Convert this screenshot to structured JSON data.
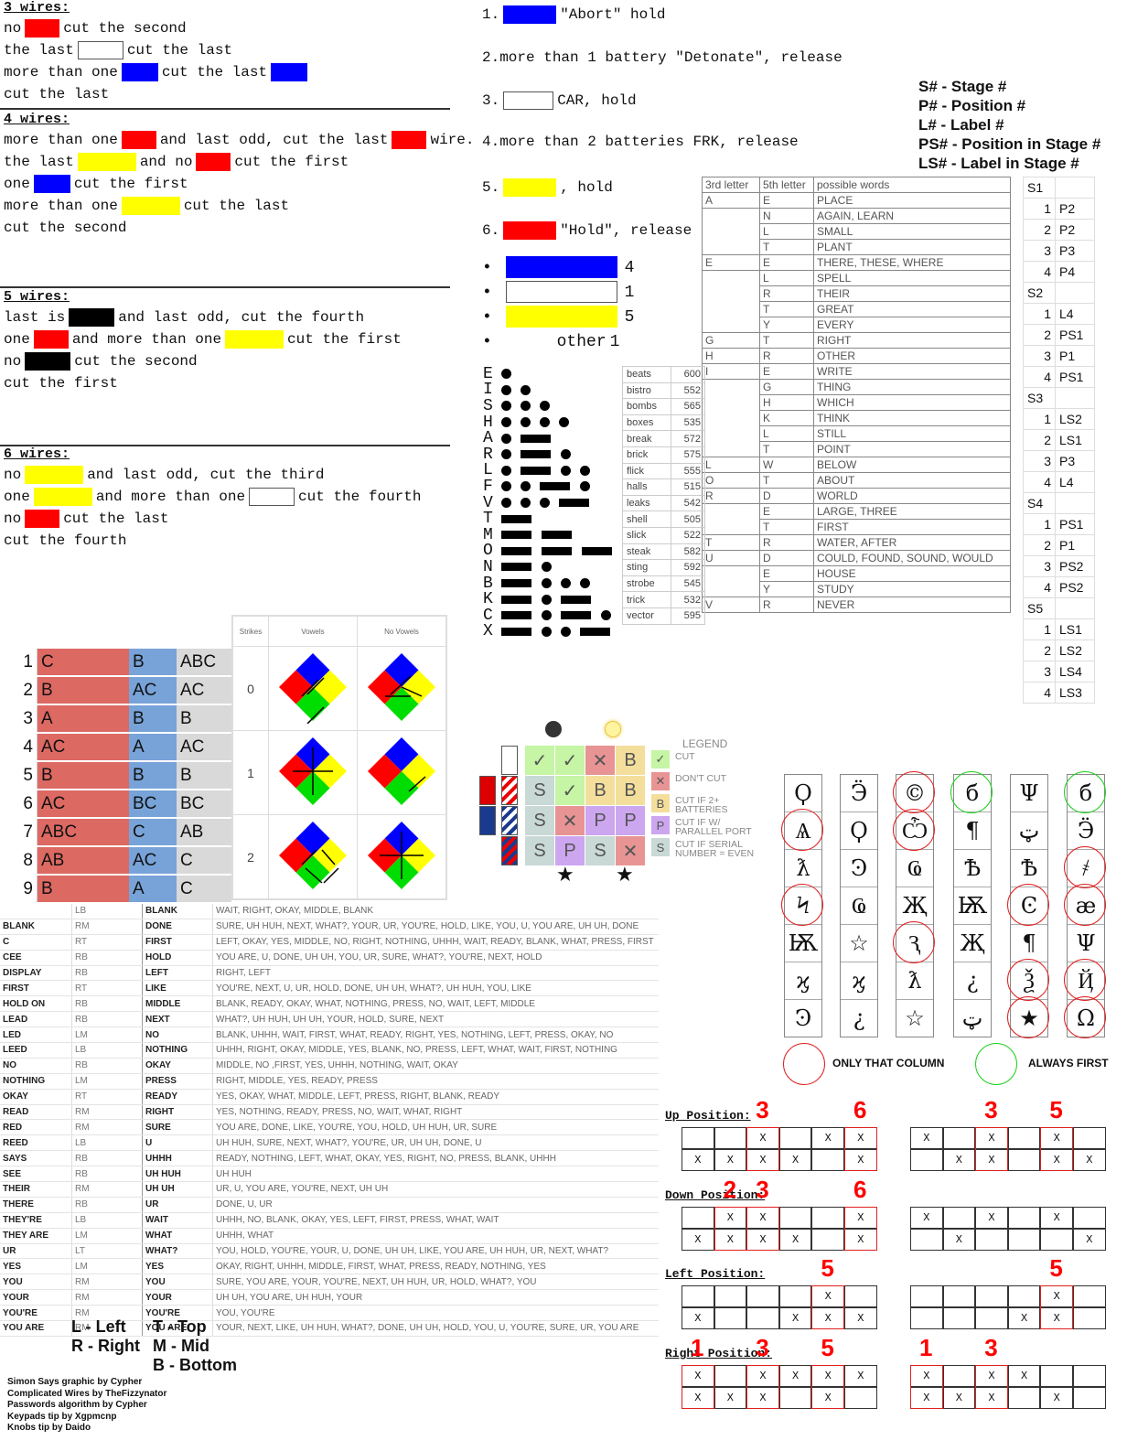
{
  "wires": {
    "s3": {
      "title": "3 wires:",
      "lines": [
        {
          "pre": "no",
          "sw": "red",
          "post": "cut the second"
        },
        {
          "pre": "the last",
          "sw": "white",
          "post": "cut the last"
        },
        {
          "pre": "more than one",
          "sw": "blue",
          "post": "cut the last",
          "sw2": "blue"
        },
        {
          "pre": "cut the last"
        }
      ]
    },
    "s4": {
      "title": "4 wires:",
      "lines": [
        {
          "pre": "more than one",
          "sw": "red",
          "post": "and  last  odd, cut the last",
          "sw2": "red",
          "post2": "wire."
        },
        {
          "pre": "the last",
          "sw": "yellow",
          "post": "and no",
          "sw2": "red",
          "post2": "cut the first"
        },
        {
          "pre": "one",
          "sw": "blue",
          "post": "cut the first"
        },
        {
          "pre": "more than one",
          "sw": "yellow",
          "post": "cut the last"
        },
        {
          "pre": "cut the second"
        }
      ]
    },
    "s5": {
      "title": "5 wires:",
      "lines": [
        {
          "pre": "last is",
          "sw": "black",
          "post": "and  last  odd, cut the fourth"
        },
        {
          "pre": "one",
          "sw": "red",
          "post": "and  more than one",
          "sw2": "yellow",
          "post2": "cut the first"
        },
        {
          "pre": "no",
          "sw": "black",
          "post": "cut the second"
        },
        {
          "pre": "cut the first"
        }
      ]
    },
    "s6": {
      "title": "6 wires:",
      "lines": [
        {
          "pre": "no",
          "sw": "yellow",
          "post": "and  last  odd, cut  the third"
        },
        {
          "pre": "one",
          "sw": "yellow",
          "post": "and  more than one",
          "sw2": "white",
          "post2": "cut the fourth"
        },
        {
          "pre": "no",
          "sw": "red",
          "post": "cut the last"
        },
        {
          "pre": "cut the fourth"
        }
      ]
    }
  },
  "button": {
    "rules": [
      {
        "num": "1.",
        "sw": "blue",
        "text": "\"Abort\" hold"
      },
      {
        "num": "2.",
        "text": "more than 1 battery \"Detonate\", release"
      },
      {
        "num": "3.",
        "sw": "white",
        "text": "CAR,  hold"
      },
      {
        "num": "4.",
        "text": "more than 2 batteries FRK, release"
      },
      {
        "num": "5.",
        "sw": "yellow",
        "text": ", hold"
      },
      {
        "num": "6.",
        "sw": "red",
        "text": "\"Hold\", release"
      }
    ],
    "strips": [
      {
        "color": "blue",
        "value": "4"
      },
      {
        "color": "white",
        "value": "1"
      },
      {
        "color": "yellow",
        "value": "5"
      },
      {
        "label": "other",
        "value": "1"
      }
    ]
  },
  "passwords": {
    "headers": [
      "3rd letter",
      "5th letter",
      "possible words"
    ],
    "rows": [
      [
        "A",
        "E",
        "PLACE"
      ],
      [
        "",
        "N",
        "AGAIN, LEARN"
      ],
      [
        "",
        "L",
        "SMALL"
      ],
      [
        "",
        "T",
        "PLANT"
      ],
      [
        "E",
        "E",
        "THERE, THESE, WHERE"
      ],
      [
        "",
        "L",
        "SPELL"
      ],
      [
        "",
        "R",
        "THEIR"
      ],
      [
        "",
        "T",
        "GREAT"
      ],
      [
        "",
        "Y",
        "EVERY"
      ],
      [
        "G",
        "T",
        "RIGHT"
      ],
      [
        "H",
        "R",
        "OTHER"
      ],
      [
        "I",
        "E",
        "WRITE"
      ],
      [
        "",
        "G",
        "THING"
      ],
      [
        "",
        "H",
        "WHICH"
      ],
      [
        "",
        "K",
        "THINK"
      ],
      [
        "",
        "L",
        "STILL"
      ],
      [
        "",
        "T",
        "POINT"
      ],
      [
        "L",
        "W",
        "BELOW"
      ],
      [
        "O",
        "T",
        "ABOUT"
      ],
      [
        "R",
        "D",
        "WORLD"
      ],
      [
        "",
        "E",
        "LARGE, THREE"
      ],
      [
        "",
        "T",
        "FIRST"
      ],
      [
        "T",
        "R",
        "WATER, AFTER"
      ],
      [
        "U",
        "D",
        "COULD, FOUND, SOUND, WOULD"
      ],
      [
        "",
        "E",
        "HOUSE"
      ],
      [
        "",
        "Y",
        "STUDY"
      ],
      [
        "V",
        "R",
        "NEVER"
      ]
    ]
  },
  "frequencies": [
    [
      "beats",
      "600"
    ],
    [
      "bistro",
      "552"
    ],
    [
      "bombs",
      "565"
    ],
    [
      "boxes",
      "535"
    ],
    [
      "break",
      "572"
    ],
    [
      "brick",
      "575"
    ],
    [
      "flick",
      "555"
    ],
    [
      "halls",
      "515"
    ],
    [
      "leaks",
      "542"
    ],
    [
      "shell",
      "505"
    ],
    [
      "slick",
      "522"
    ],
    [
      "steak",
      "582"
    ],
    [
      "sting",
      "592"
    ],
    [
      "strobe",
      "545"
    ],
    [
      "trick",
      "532"
    ],
    [
      "vector",
      "595"
    ]
  ],
  "memory": {
    "codes": [
      "S# - Stage #",
      "P# - Position #",
      "L# - Label #",
      "PS# - Position in Stage #",
      "LS# - Label in Stage #"
    ],
    "stages": [
      {
        "label": "S1",
        "steps": [
          "P2",
          "P2",
          "P3",
          "P4"
        ]
      },
      {
        "label": "S2",
        "steps": [
          "L4",
          "PS1",
          "P1",
          "PS1"
        ]
      },
      {
        "label": "S3",
        "steps": [
          "LS2",
          "LS1",
          "P3",
          "L4"
        ]
      },
      {
        "label": "S4",
        "steps": [
          "PS1",
          "P1",
          "PS2",
          "PS2"
        ]
      },
      {
        "label": "S5",
        "steps": [
          "LS1",
          "LS2",
          "LS4",
          "LS3"
        ]
      }
    ]
  },
  "morse": [
    {
      "l": "E",
      "c": "."
    },
    {
      "l": "I",
      "c": ".."
    },
    {
      "l": "S",
      "c": "..."
    },
    {
      "l": "H",
      "c": "...."
    },
    {
      "l": "A",
      "c": ".-"
    },
    {
      "l": "R",
      "c": ".-."
    },
    {
      "l": "L",
      "c": ".-.."
    },
    {
      "l": "F",
      "c": "..-."
    },
    {
      "l": "V",
      "c": "...-"
    },
    {
      "l": "T",
      "c": "-"
    },
    {
      "l": "M",
      "c": "--"
    },
    {
      "l": "O",
      "c": "---"
    },
    {
      "l": "N",
      "c": "-."
    },
    {
      "l": "B",
      "c": "-..."
    },
    {
      "l": "K",
      "c": "-.-"
    },
    {
      "l": "C",
      "c": "-.-."
    },
    {
      "l": "X",
      "c": "-..-"
    }
  ],
  "wof_steps": [
    [
      "1",
      "C",
      "B",
      "ABC"
    ],
    [
      "2",
      "B",
      "AC",
      "AC"
    ],
    [
      "3",
      "A",
      "B",
      "B"
    ],
    [
      "4",
      "AC",
      "A",
      "AC"
    ],
    [
      "5",
      "B",
      "B",
      "B"
    ],
    [
      "6",
      "AC",
      "BC",
      "BC"
    ],
    [
      "7",
      "ABC",
      "C",
      "AB"
    ],
    [
      "8",
      "AB",
      "AC",
      "C"
    ],
    [
      "9",
      "B",
      "A",
      "C"
    ]
  ],
  "simon": {
    "headers": [
      "Strikes",
      "Vowels",
      "No Vowels"
    ],
    "rows": [
      "0",
      "1",
      "2"
    ]
  },
  "complicated": {
    "legend_title": "LEGEND",
    "grid": [
      [
        "C",
        "C",
        "X",
        "B"
      ],
      [
        "S",
        "C",
        "B",
        "B"
      ],
      [
        "S",
        "X",
        "P",
        "P"
      ],
      [
        "S",
        "P",
        "S",
        "X"
      ]
    ],
    "legend": [
      {
        "code": "C",
        "label": "CUT"
      },
      {
        "code": "X",
        "label": "DON'T CUT"
      },
      {
        "code": "B",
        "label": "CUT IF 2+ BATTERIES"
      },
      {
        "code": "P",
        "label": "CUT IF W/ PARALLEL PORT"
      },
      {
        "code": "S",
        "label": "CUT IF SERIAL NUMBER = EVEN"
      }
    ]
  },
  "keypad": {
    "columns": [
      [
        {
          "g": "Ϙ"
        },
        {
          "g": "Ѧ",
          "r": "red"
        },
        {
          "g": "ƛ"
        },
        {
          "g": "Ϟ",
          "r": "red"
        },
        {
          "g": "Ѭ"
        },
        {
          "g": "ϗ"
        },
        {
          "g": "Ͽ"
        }
      ],
      [
        {
          "g": "Ӭ"
        },
        {
          "g": "Ϙ"
        },
        {
          "g": "Ͽ"
        },
        {
          "g": "Ҩ"
        },
        {
          "g": "☆"
        },
        {
          "g": "ϗ"
        },
        {
          "g": "¿"
        }
      ],
      [
        {
          "g": "©",
          "r": "red"
        },
        {
          "g": "Ѽ",
          "r": "red"
        },
        {
          "g": "Ҩ"
        },
        {
          "g": "Җ"
        },
        {
          "g": "Ԇ",
          "r": "red"
        },
        {
          "g": "ƛ"
        },
        {
          "g": "☆"
        }
      ],
      [
        {
          "g": "б",
          "r": "green"
        },
        {
          "g": "¶"
        },
        {
          "g": "Ѣ"
        },
        {
          "g": "Ѭ"
        },
        {
          "g": "Җ"
        },
        {
          "g": "¿"
        },
        {
          "g": "ټ"
        }
      ],
      [
        {
          "g": "Ψ"
        },
        {
          "g": "ټ"
        },
        {
          "g": "Ѣ"
        },
        {
          "g": "Ͼ",
          "r": "red"
        },
        {
          "g": "¶"
        },
        {
          "g": "Ѯ",
          "r": "red"
        },
        {
          "g": "★",
          "r": "red"
        }
      ],
      [
        {
          "g": "б",
          "r": "green"
        },
        {
          "g": "Ӭ"
        },
        {
          "g": "҂",
          "r": "red"
        },
        {
          "g": "æ",
          "r": "red"
        },
        {
          "g": "Ψ"
        },
        {
          "g": "Ҋ",
          "r": "red"
        },
        {
          "g": "Ω",
          "r": "red"
        }
      ]
    ],
    "legend_red": "ONLY THAT COLUMN",
    "legend_green": "ALWAYS FIRST"
  },
  "whos_on_first": {
    "display_rows": [
      [
        "",
        "LB"
      ],
      [
        "BLANK",
        "RM"
      ],
      [
        "C",
        "RT"
      ],
      [
        "CEE",
        "RB"
      ],
      [
        "DISPLAY",
        "RB"
      ],
      [
        "FIRST",
        "RT"
      ],
      [
        "HOLD ON",
        "RB"
      ],
      [
        "LEAD",
        "RB"
      ],
      [
        "LED",
        "LM"
      ],
      [
        "LEED",
        "LB"
      ],
      [
        "NO",
        "RB"
      ],
      [
        "NOTHING",
        "LM"
      ],
      [
        "OKAY",
        "RT"
      ],
      [
        "READ",
        "RM"
      ],
      [
        "RED",
        "RM"
      ],
      [
        "REED",
        "LB"
      ],
      [
        "SAYS",
        "RB"
      ],
      [
        "SEE",
        "RB"
      ],
      [
        "THEIR",
        "RM"
      ],
      [
        "THERE",
        "RB"
      ],
      [
        "THEY'RE",
        "LB"
      ],
      [
        "THEY ARE",
        "LM"
      ],
      [
        "UR",
        "LT"
      ],
      [
        "YES",
        "LM"
      ],
      [
        "YOU",
        "RM"
      ],
      [
        "YOUR",
        "RM"
      ],
      [
        "YOU'RE",
        "RM"
      ],
      [
        "YOU ARE",
        "RM"
      ]
    ],
    "word_rows": [
      [
        "BLANK",
        "WAIT, RIGHT, OKAY, MIDDLE, BLANK"
      ],
      [
        "DONE",
        "SURE, UH HUH, NEXT, WHAT?, YOUR, UR, YOU'RE, HOLD, LIKE, YOU, U, YOU ARE, UH UH, DONE"
      ],
      [
        "FIRST",
        "LEFT, OKAY, YES, MIDDLE, NO, RIGHT, NOTHING, UHHH, WAIT, READY, BLANK, WHAT, PRESS, FIRST"
      ],
      [
        "HOLD",
        "YOU ARE, U, DONE, UH UH, YOU, UR, SURE, WHAT?, YOU'RE, NEXT, HOLD"
      ],
      [
        "LEFT",
        "RIGHT, LEFT"
      ],
      [
        "LIKE",
        "YOU'RE, NEXT, U, UR, HOLD, DONE, UH UH, WHAT?, UH HUH, YOU, LIKE"
      ],
      [
        "MIDDLE",
        "BLANK, READY, OKAY, WHAT, NOTHING, PRESS, NO, WAIT, LEFT, MIDDLE"
      ],
      [
        "NEXT",
        "WHAT?, UH HUH, UH UH, YOUR, HOLD, SURE, NEXT"
      ],
      [
        "NO",
        "BLANK, UHHH, WAIT, FIRST, WHAT, READY, RIGHT, YES, NOTHING, LEFT, PRESS, OKAY, NO"
      ],
      [
        "NOTHING",
        "UHHH, RIGHT, OKAY, MIDDLE, YES, BLANK, NO, PRESS, LEFT, WHAT, WAIT, FIRST, NOTHING"
      ],
      [
        "OKAY",
        "MIDDLE, NO ,FIRST, YES, UHHH, NOTHING, WAIT, OKAY"
      ],
      [
        "PRESS",
        "RIGHT, MIDDLE, YES, READY, PRESS"
      ],
      [
        "READY",
        "YES, OKAY, WHAT, MIDDLE, LEFT, PRESS, RIGHT, BLANK, READY"
      ],
      [
        "RIGHT",
        "YES, NOTHING, READY, PRESS, NO, WAIT, WHAT, RIGHT"
      ],
      [
        "SURE",
        "YOU ARE, DONE, LIKE, YOU'RE, YOU, HOLD, UH HUH, UR, SURE"
      ],
      [
        "U",
        "UH HUH, SURE, NEXT, WHAT?, YOU'RE, UR, UH UH, DONE, U"
      ],
      [
        "UHHH",
        "READY, NOTHING, LEFT, WHAT, OKAY, YES, RIGHT, NO, PRESS, BLANK, UHHH"
      ],
      [
        "UH HUH",
        "UH HUH"
      ],
      [
        "UH UH",
        "UR, U, YOU ARE, YOU'RE, NEXT, UH UH"
      ],
      [
        "UR",
        "DONE, U, UR"
      ],
      [
        "WAIT",
        "UHHH, NO, BLANK, OKAY, YES, LEFT, FIRST, PRESS, WHAT, WAIT"
      ],
      [
        "WHAT",
        "UHHH, WHAT"
      ],
      [
        "WHAT?",
        "YOU, HOLD, YOU'RE, YOUR, U, DONE, UH UH, LIKE, YOU ARE, UH HUH, UR, NEXT, WHAT?"
      ],
      [
        "YES",
        "OKAY, RIGHT, UHHH, MIDDLE, FIRST, WHAT, PRESS, READY, NOTHING, YES"
      ],
      [
        "YOU",
        "SURE, YOU ARE, YOUR, YOU'RE, NEXT, UH HUH, UR, HOLD, WHAT?, YOU"
      ],
      [
        "YOUR",
        "UH UH, YOU ARE, UH HUH, YOUR"
      ],
      [
        "YOU'RE",
        "YOU, YOU'RE"
      ],
      [
        "YOU ARE",
        "YOUR, NEXT, LIKE, UH HUH, WHAT?, DONE, UH UH, HOLD, YOU, U, YOU'RE, SURE, UR, YOU ARE"
      ]
    ],
    "position_key_left": [
      "L - Left",
      "R - Right"
    ],
    "position_key_right": [
      "T - Top",
      "M - Mid",
      "B - Bottom"
    ]
  },
  "credits": [
    "Simon Says graphic by Cypher",
    "Complicated Wires by TheFizzynator",
    "Passwords algorithm by Cypher",
    "Keypads tip by Xgpmcnp",
    "Knobs tip by Daido"
  ],
  "knobs": [
    {
      "title": "Up Position:",
      "grids": [
        {
          "top": [
            "",
            "",
            "X",
            "",
            "X",
            "X"
          ],
          "bottom": [
            "X",
            "X",
            "X",
            "X",
            "",
            "X"
          ],
          "highlight": [
            3,
            6
          ]
        },
        {
          "top": [
            "X",
            "",
            "X",
            "",
            "X",
            ""
          ],
          "bottom": [
            "",
            "X",
            "X",
            "",
            "X",
            "X"
          ],
          "highlight": [
            3,
            5
          ]
        }
      ]
    },
    {
      "title": "Down Position:",
      "grids": [
        {
          "top": [
            "",
            "X",
            "X",
            "",
            "",
            "X"
          ],
          "bottom": [
            "X",
            "X",
            "X",
            "X",
            "",
            "X"
          ],
          "highlight": [
            2,
            3,
            6
          ]
        },
        {
          "top": [
            "X",
            "",
            "X",
            "",
            "X",
            ""
          ],
          "bottom": [
            "",
            "X",
            "",
            "",
            "",
            "X"
          ],
          "highlight": []
        }
      ]
    },
    {
      "title": "Left Position:",
      "grids": [
        {
          "top": [
            "",
            "",
            "",
            "",
            "X",
            ""
          ],
          "bottom": [
            "X",
            "",
            "",
            "X",
            "X",
            "X"
          ],
          "highlight": [
            5
          ]
        },
        {
          "top": [
            "",
            "",
            "",
            "",
            "X",
            ""
          ],
          "bottom": [
            "",
            "",
            "",
            "X",
            "X",
            ""
          ],
          "highlight": [
            5
          ]
        }
      ]
    },
    {
      "title": "Right Position:",
      "grids": [
        {
          "top": [
            "X",
            "",
            "X",
            "X",
            "X",
            "X"
          ],
          "bottom": [
            "X",
            "X",
            "X",
            "",
            "X",
            ""
          ],
          "highlight": [
            1,
            3,
            5
          ]
        },
        {
          "top": [
            "X",
            "",
            "X",
            "X",
            "",
            ""
          ],
          "bottom": [
            "X",
            "X",
            "X",
            "",
            "X",
            ""
          ],
          "highlight": [
            1,
            3
          ]
        }
      ]
    }
  ]
}
